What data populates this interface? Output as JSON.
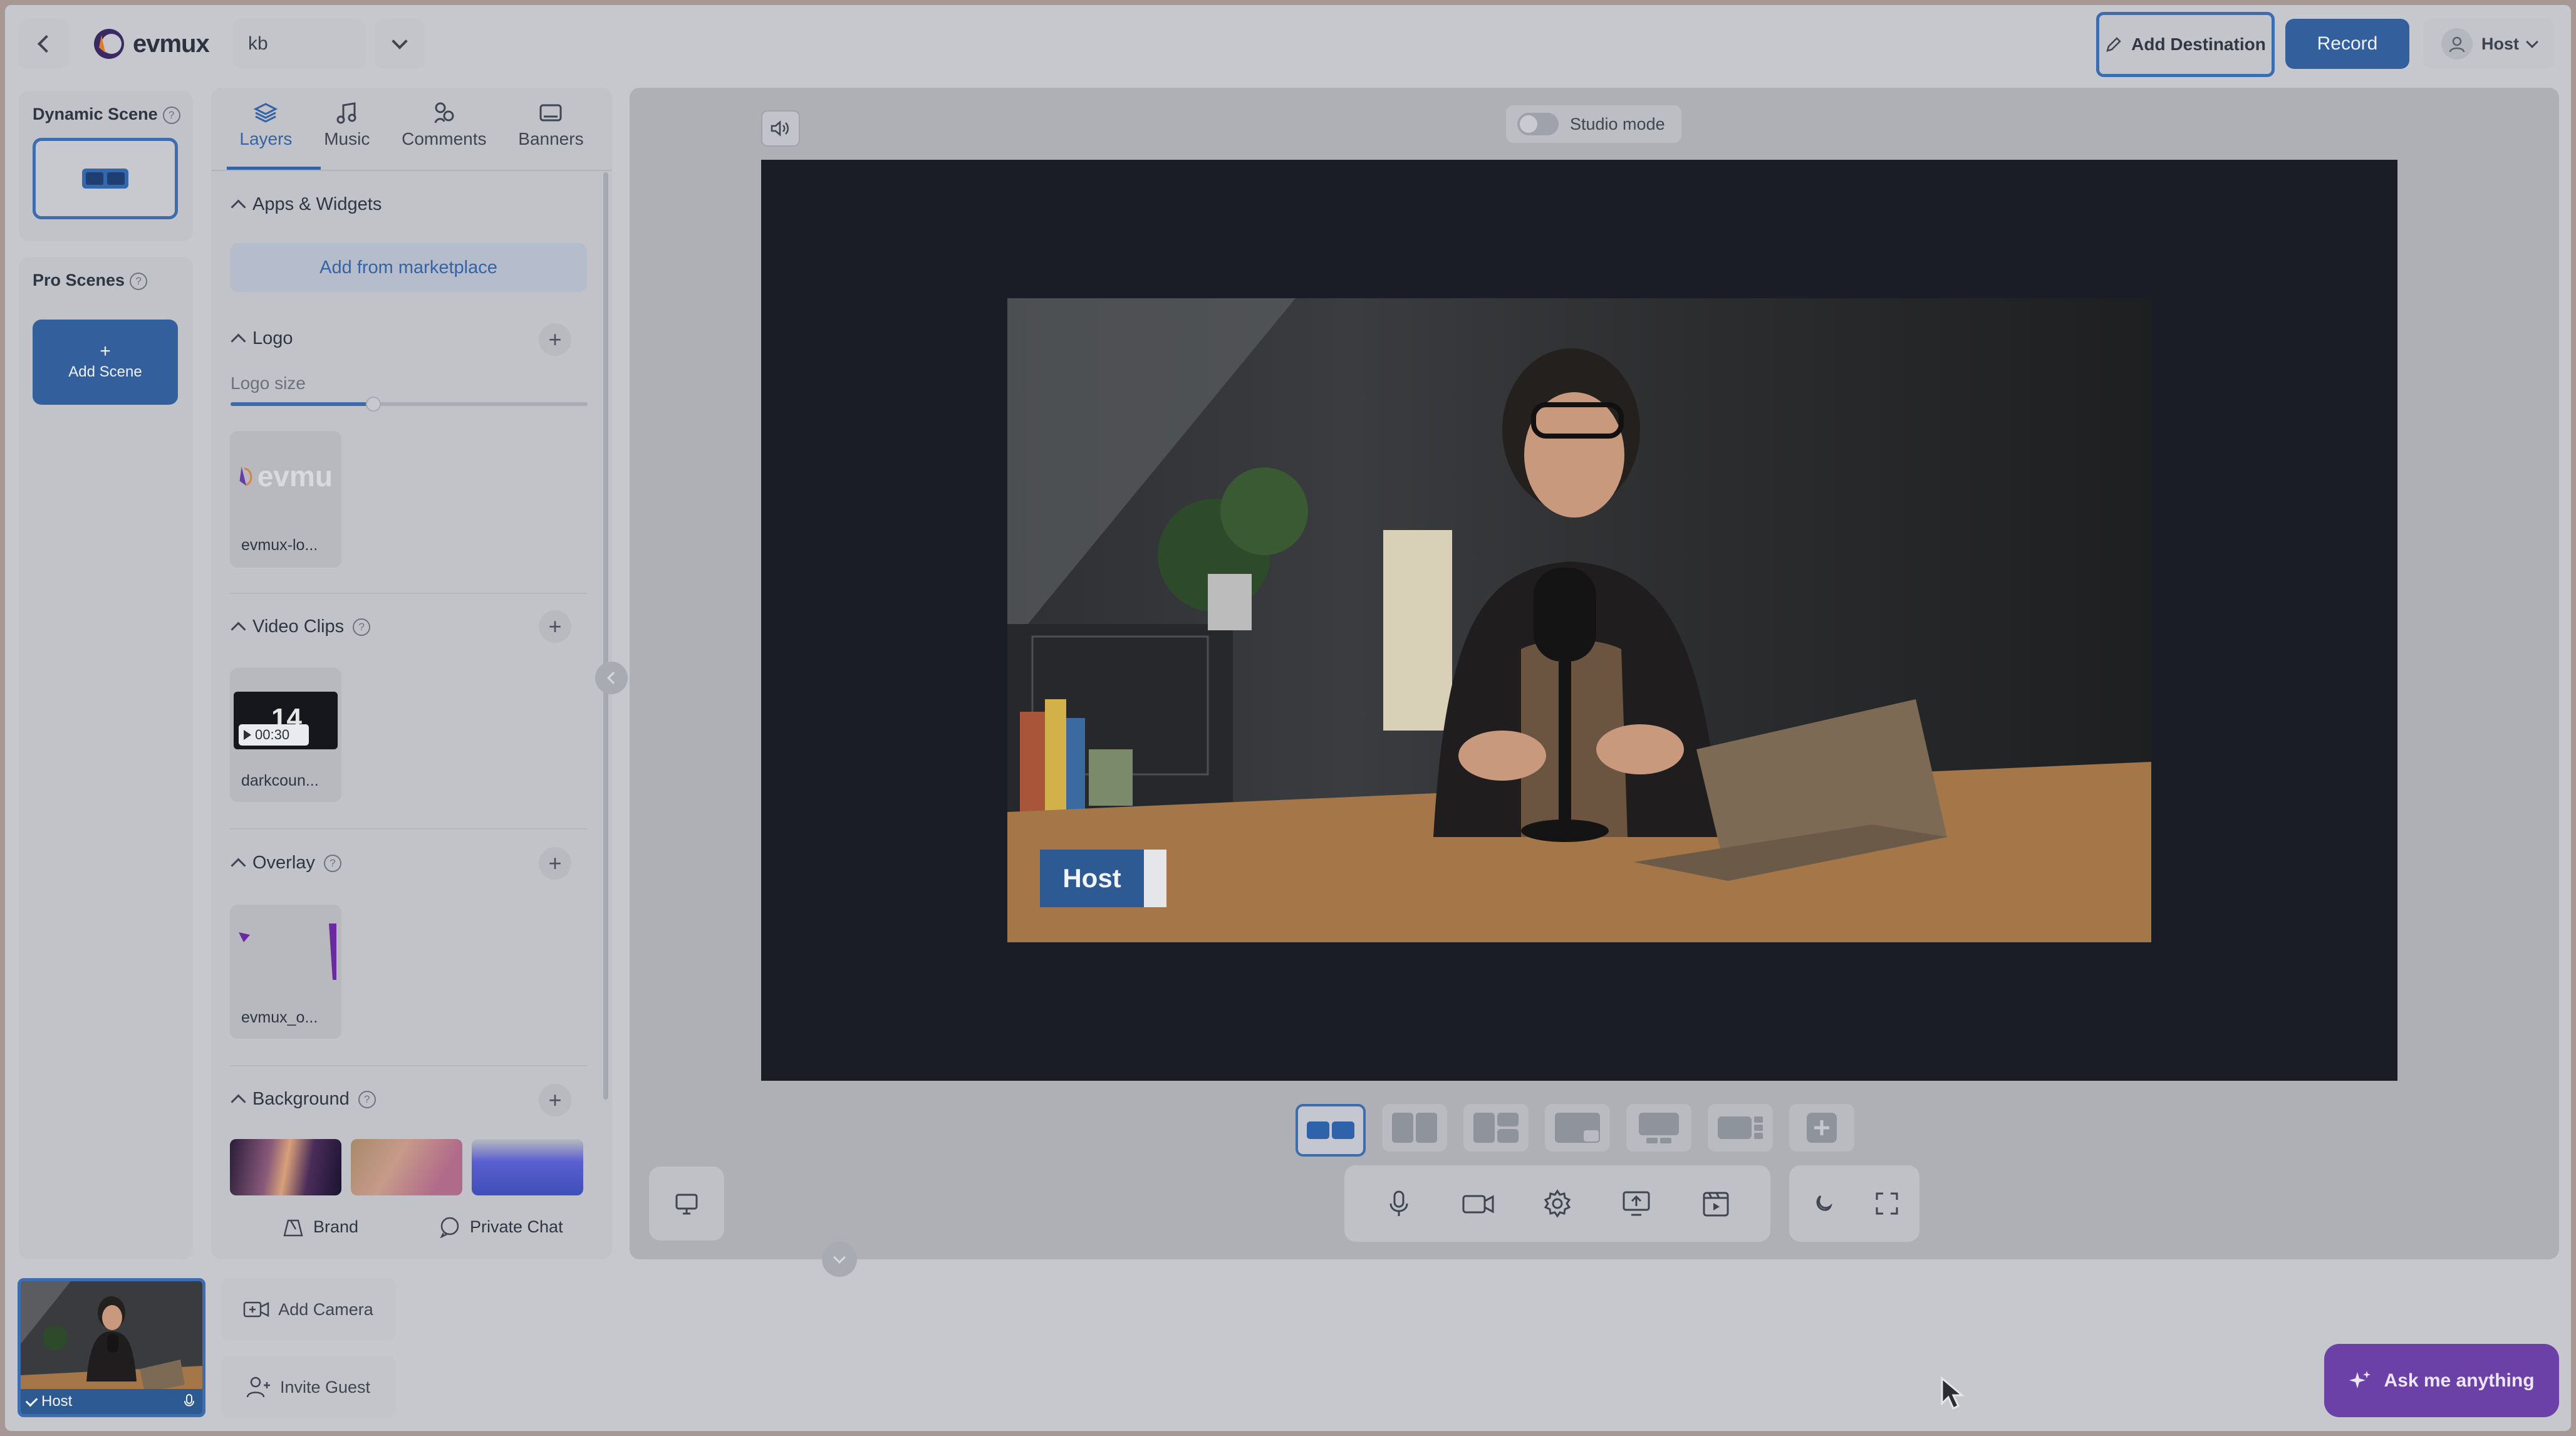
{
  "header": {
    "logo_text": "evmux",
    "workspace": "kb",
    "add_destination": "Add Destination",
    "record": "Record",
    "user": "Host"
  },
  "left": {
    "dynamic_scene": "Dynamic Scene",
    "pro_scenes": "Pro Scenes",
    "add_scene": "Add Scene",
    "help_glyph": "?"
  },
  "tabs": [
    {
      "label": "Layers",
      "icon": "layers-icon"
    },
    {
      "label": "Music",
      "icon": "music-icon"
    },
    {
      "label": "Comments",
      "icon": "comments-icon"
    },
    {
      "label": "Banners",
      "icon": "banners-icon"
    }
  ],
  "sections": {
    "apps": "Apps & Widgets",
    "add_marketplace": "Add from marketplace",
    "logo": "Logo",
    "logo_size": "Logo size",
    "logo_size_value": 0.4,
    "logo_item": "evmux-lo...",
    "logo_thumb_text": "evmu",
    "video_clips": "Video Clips",
    "video_item": "darkcoun...",
    "video_duration": "00:30",
    "video_thumb_text": "14",
    "overlay": "Overlay",
    "overlay_item": "evmux_o...",
    "background": "Background"
  },
  "bottom_links": {
    "brand": "Brand",
    "private_chat": "Private Chat"
  },
  "stage": {
    "studio_mode": "Studio mode",
    "name_tag": "Host"
  },
  "participants": {
    "host_label": "Host",
    "add_camera": "Add Camera",
    "invite_guest": "Invite Guest"
  },
  "assistant": {
    "label": "Ask me anything"
  },
  "colors": {
    "accent": "#335f9d",
    "assistant": "#6b41a8"
  }
}
